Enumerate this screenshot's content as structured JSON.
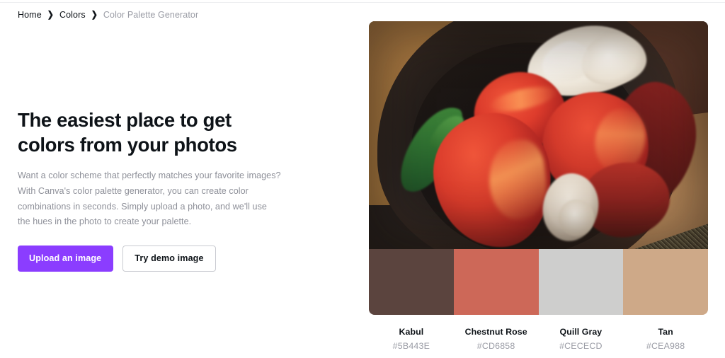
{
  "breadcrumb": {
    "items": [
      {
        "label": "Home",
        "current": false
      },
      {
        "label": "Colors",
        "current": false
      },
      {
        "label": "Color Palette Generator",
        "current": true
      }
    ],
    "separator": "❯"
  },
  "hero": {
    "title": "The easiest place to get colors from your photos",
    "description": "Want a color scheme that perfectly matches your favorite images? With Canva's color palette generator, you can create color combinations in seconds. Simply upload a photo, and we'll use the hues in the photo to create your palette.",
    "primary_button": "Upload an image",
    "secondary_button": "Try demo image"
  },
  "preview": {
    "image_alt": "Bouquet of red tulips with a white tulip and a green leaf wrapped in kraft paper",
    "palette": [
      {
        "name": "Kabul",
        "hex": "#5B443E"
      },
      {
        "name": "Chestnut Rose",
        "hex": "#CD6858"
      },
      {
        "name": "Quill Gray",
        "hex": "#CECECD"
      },
      {
        "name": "Tan",
        "hex": "#CEA988"
      }
    ]
  },
  "theme": {
    "brand_purple": "#8B3DFF",
    "text_dark": "#0E1318",
    "text_muted": "#8E9099",
    "border_light": "#C9CBD1"
  }
}
